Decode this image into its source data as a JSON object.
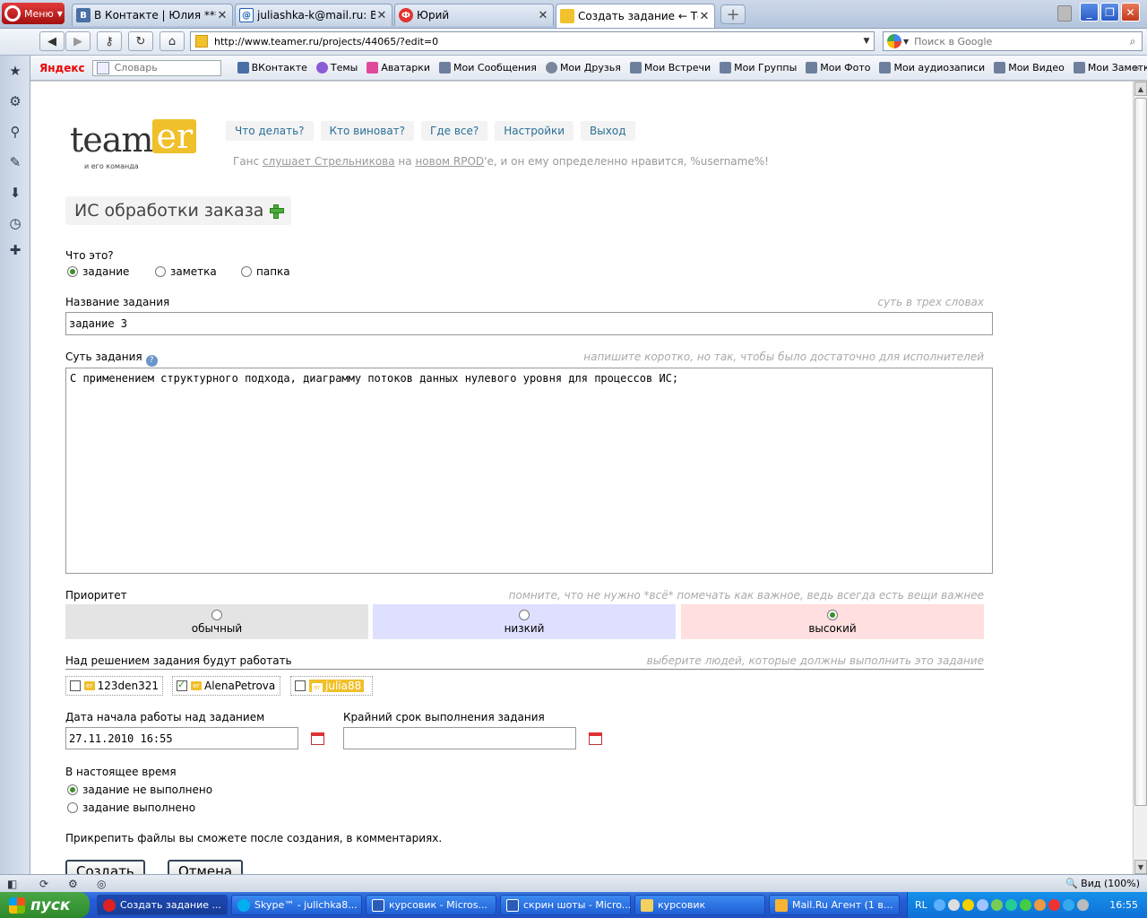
{
  "browser": {
    "menu_label": "Меню",
    "tabs": [
      {
        "label": "В Контакте | Юлия ***...",
        "icon": "В"
      },
      {
        "label": "juliashka-k@mail.ru: Вхо...",
        "icon": "@"
      },
      {
        "label": "Юрий",
        "icon": "Ф"
      },
      {
        "label": "Создать задание ← Те...",
        "icon": ""
      }
    ],
    "url": "http://www.teamer.ru/projects/44065/?edit=0",
    "search_placeholder": "Поиск в Google"
  },
  "bookmarks": {
    "yandex_label": "Яндекс",
    "yandex_placeholder": "Словарь",
    "items": [
      "ВКонтакте",
      "Темы",
      "Аватарки",
      "Мои Сообщения",
      "Мои Друзья",
      "Мои Встречи",
      "Мои Группы",
      "Мои Фото",
      "Мои аудиозаписи",
      "Мои Видео",
      "Мои Заметки"
    ]
  },
  "site": {
    "logo_team": "team",
    "logo_er": "er",
    "logo_tagline": "и его команда",
    "nav": [
      "Что делать?",
      "Кто виноват?",
      "Где все?",
      "Настройки",
      "Выход"
    ],
    "status": {
      "p1": "Ганс ",
      "link1": "слушает Стрельникова",
      "p2": " на ",
      "link2": "новом RPOD",
      "p3": "'е, и он ему определенно нравится, %username%!"
    }
  },
  "form": {
    "project_title": "ИС обработки заказа",
    "type_label": "Что это?",
    "type_options": [
      "задание",
      "заметка",
      "папка"
    ],
    "name_label": "Название задания",
    "name_hint": "суть в трех словах",
    "name_value": "задание 3",
    "desc_label": "Суть задания",
    "desc_hint": "напишите коротко, но так, чтобы было достаточно для исполнителей",
    "desc_value": "С применением структурного подхода, диаграмму потоков данных нулевого уровня для процессов ИС;",
    "priority_label": "Приоритет",
    "priority_hint": "помните, что не нужно *всё* помечать как важное, ведь всегда есть вещи важнее",
    "priority_options": [
      "обычный",
      "низкий",
      "высокий"
    ],
    "priority_colors": [
      "#e4e4e4",
      "#dfe0ff",
      "#ffdfdf"
    ],
    "workers_label": "Над решением задания будут работать",
    "workers_hint": "выберите людей, которые должны выполнить это задание",
    "workers": [
      "123den321",
      "AlenaPetrova",
      "julia88"
    ],
    "badge": "er",
    "start_label": "Дата начала работы над заданием",
    "start_value": "27.11.2010 16:55",
    "deadline_label": "Крайний срок выполнения задания",
    "deadline_value": "",
    "state_label": "В настоящее время",
    "state_options": [
      "задание не выполнено",
      "задание выполнено"
    ],
    "files_note": "Прикрепить файлы вы сможете после создания, в комментариях.",
    "create_button": "Создать",
    "cancel_button": "Отмена"
  },
  "statusbar": {
    "zoom": "Вид (100%)"
  },
  "taskbar": {
    "start_label": "пуск",
    "tasks": [
      "Создать задание ...",
      "Skype™ - julichka8...",
      "курсовик - Micros...",
      "скрин шоты - Micro...",
      "курсовик",
      "Mail.Ru Агент (1 в..."
    ],
    "lang": "RL",
    "clock": "16:55"
  }
}
